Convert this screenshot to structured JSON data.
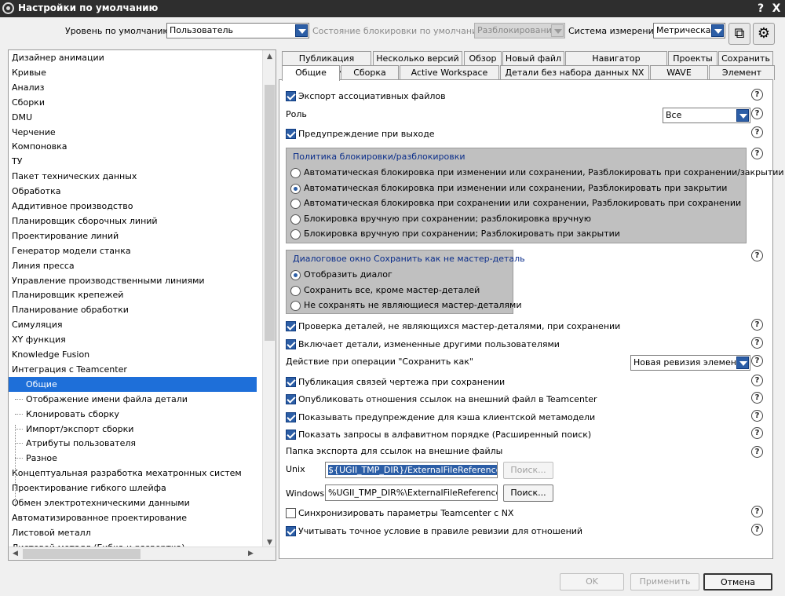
{
  "window": {
    "title": "Настройки по умолчанию",
    "help_label": "?",
    "close_label": "X"
  },
  "header": {
    "level_label": "Уровень по умолчанию",
    "level_value": "Пользователь",
    "lock_label": "Состояние блокировки по умолчанию",
    "lock_value": "Разблокирование",
    "units_label": "Система измерения",
    "units_value": "Метрическая"
  },
  "tree": {
    "items": [
      "Дизайнер анимации",
      "Кривые",
      "Анализ",
      "Сборки",
      "DMU",
      "Черчение",
      "Компоновка",
      "ТУ",
      "Пакет технических данных",
      "Обработка",
      "Аддитивное производство",
      "Планировщик сборочных линий",
      "Проектирование линий",
      "Генератор модели станка",
      "Линия пресса",
      "Управление производственными линиями",
      "Планировщик крепежей",
      "Планирование обработки",
      "Симуляция",
      "XY функция",
      "Knowledge Fusion",
      "Интеграция с Teamcenter"
    ],
    "children": [
      "Общие",
      "Отображение имени файла детали",
      "Клонировать сборку",
      "Импорт/экспорт сборки",
      "Атрибуты пользователя",
      "Разное"
    ],
    "after": [
      "Концептуальная разработка мехатронных систем",
      "Проектирование гибкого шлейфа",
      "Обмен электротехническими данными",
      "Автоматизированное проектирование",
      "Листовой металл",
      "Листовой металл (Гибка и развертка)"
    ]
  },
  "tabs": {
    "row1": [
      "Публикация сварки",
      "Несколько версий",
      "Обзор",
      "Новый файл",
      "Навигатор Teamcenter",
      "Проекты",
      "Сохранить"
    ],
    "row2": [
      "Общие",
      "Сборка",
      "Active Workspace",
      "Детали без набора данных NX",
      "WAVE",
      "Элемент"
    ]
  },
  "general": {
    "export_assoc": "Экспорт ассоциативных файлов",
    "role_label": "Роль",
    "role_value": "Все",
    "warn_exit": "Предупреждение при выходе",
    "lock_policy": {
      "title": "Политика блокировки/разблокировки",
      "options": [
        "Автоматическая блокировка при изменении или сохранении, Разблокировать при сохранении/закрытии",
        "Автоматическая блокировка при изменении или сохранении, Разблокировать при закрытии",
        "Автоматическая блокировка при сохранении или сохранении, Разблокировать при сохранении",
        "Блокировка вручную при сохранении; разблокировка вручную",
        "Блокировка вручную при сохранении; Разблокировать при закрытии"
      ]
    },
    "save_dialog": {
      "title": "Диалоговое окно Сохранить как не мастер-деталь",
      "options": [
        "Отобразить диалог",
        "Сохранить все, кроме мастер-деталей",
        "Не сохранять не являющиеся мастер-деталями"
      ]
    },
    "check_nonmaster": "Проверка деталей, не являющихся мастер-деталями, при сохранении",
    "include_modified": "Включает детали, измененные другими пользователями",
    "saveas_label": "Действие при операции \"Сохранить как\"",
    "saveas_value": "Новая ревизия элемента",
    "publish_links": "Публикация связей чертежа при сохранении",
    "publish_refs": "Опубликовать отношения ссылок на внешний файл в Teamcenter",
    "cache_warn": "Показывать предупреждение для кэша клиентской метамодели",
    "alpha_queries": "Показать запросы в алфавитном порядке (Расширенный поиск)",
    "export_folder_label": "Папка экспорта для ссылок на внешние файлы",
    "unix_label": "Unix",
    "unix_value": "${UGII_TMP_DIR}/ExternalFileReferences",
    "windows_label": "Windows",
    "windows_value": "%UGII_TMP_DIR%\\ExternalFileReferences",
    "search_label": "Поиск...",
    "sync_params": "Синхронизировать параметры Teamcenter с NX",
    "exact_condition": "Учитывать точное условие в правиле ревизии для отношений",
    "help_mark": "?"
  },
  "footer": {
    "ok": "OK",
    "apply": "Применить",
    "cancel": "Отмена"
  }
}
